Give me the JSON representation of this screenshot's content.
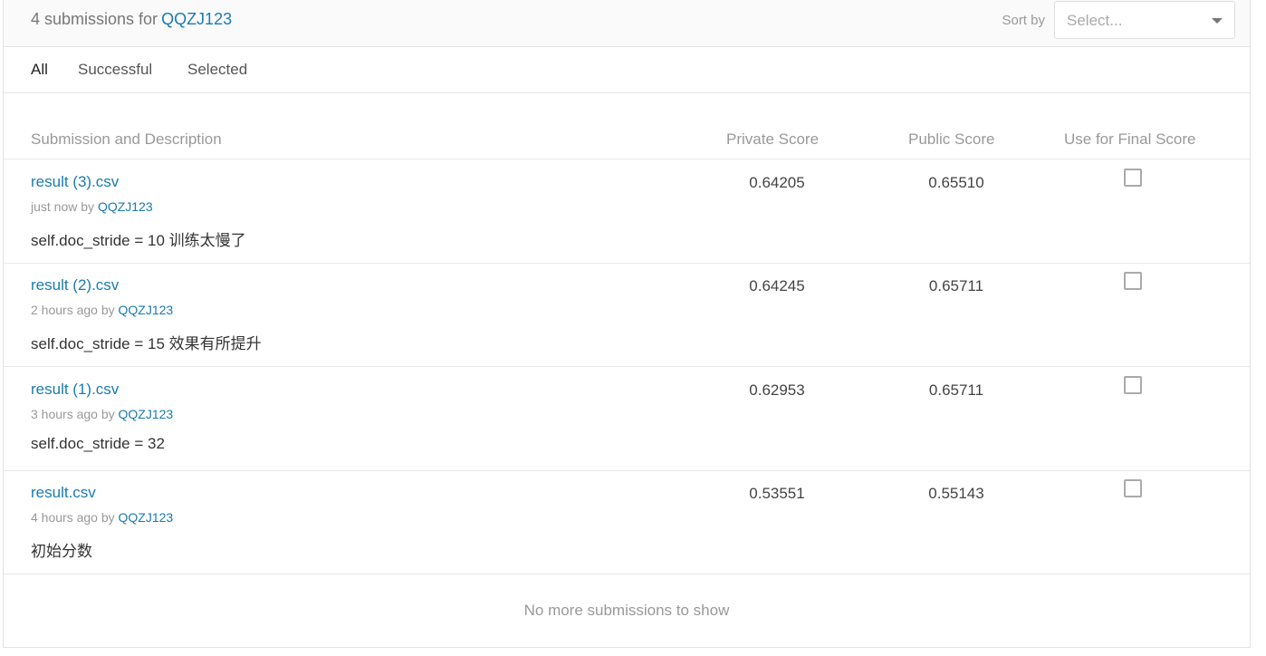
{
  "header": {
    "count_text": "4 submissions for",
    "user": "QQZJ123",
    "sort_label": "Sort by",
    "sort_placeholder": "Select..."
  },
  "tabs": [
    {
      "label": "All",
      "active": true
    },
    {
      "label": "Successful",
      "active": false
    },
    {
      "label": "Selected",
      "active": false
    }
  ],
  "columns": {
    "submission": "Submission and Description",
    "private": "Private Score",
    "public": "Public Score",
    "final": "Use for Final Score"
  },
  "rows": [
    {
      "file": "result (3).csv",
      "time": "just now",
      "by": "by",
      "user": "QQZJ123",
      "desc": "self.doc_stride = 10 训练太慢了",
      "private": "0.64205",
      "public": "0.65510",
      "selected": false
    },
    {
      "file": "result (2).csv",
      "time": "2 hours ago",
      "by": "by",
      "user": "QQZJ123",
      "desc": "self.doc_stride = 15 效果有所提升",
      "private": "0.64245",
      "public": "0.65711",
      "selected": false
    },
    {
      "file": "result (1).csv",
      "time": "3 hours ago",
      "by": "by",
      "user": "QQZJ123",
      "desc": "self.doc_stride = 32",
      "private": "0.62953",
      "public": "0.65711",
      "selected": false
    },
    {
      "file": "result.csv",
      "time": "4 hours ago",
      "by": "by",
      "user": "QQZJ123",
      "desc": "初始分数",
      "private": "0.53551",
      "public": "0.55143",
      "selected": false
    }
  ],
  "footer": "No more submissions to show"
}
